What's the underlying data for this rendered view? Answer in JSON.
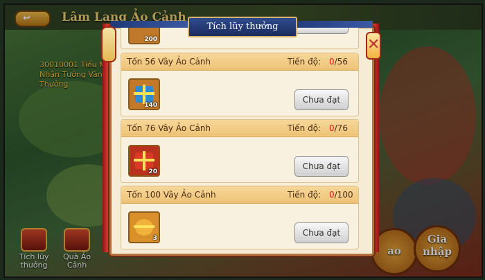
{
  "background": {
    "title": "Lâm Lang Ảo Cảnh",
    "notice": "30010001 Tiểu Mi... Nhận Tướng Vàng Thưởng",
    "bottom_left": [
      "Tích lũy thưởng",
      "Quà Ảo Cảnh"
    ],
    "right_buttons": [
      "ao",
      "Gia nhập"
    ]
  },
  "modal": {
    "title": "Tích lũy thưởng",
    "close_symbol": "✕",
    "partial_top_count": "200",
    "rows": [
      {
        "title": "Tốn 56 Vây Ảo Cảnh",
        "progress_label": "Tiến độ:",
        "current": "0",
        "target": "/56",
        "item_count": "140",
        "item_color": "#c3782a",
        "box_color": "#2e8bd1",
        "button": "Chưa đạt"
      },
      {
        "title": "Tốn 76 Vây Ảo Cảnh",
        "progress_label": "Tiến độ:",
        "current": "0",
        "target": "/76",
        "item_count": "20",
        "item_color": "#b8321e",
        "box_color": "#d83a25",
        "button": "Chưa đạt"
      },
      {
        "title": "Tốn 100 Vây Ảo Cảnh",
        "progress_label": "Tiến độ:",
        "current": "0",
        "target": "/100",
        "item_count": "3",
        "item_color": "#d9902a",
        "box_color": "#f0b23a",
        "button": "Chưa đạt"
      }
    ]
  }
}
